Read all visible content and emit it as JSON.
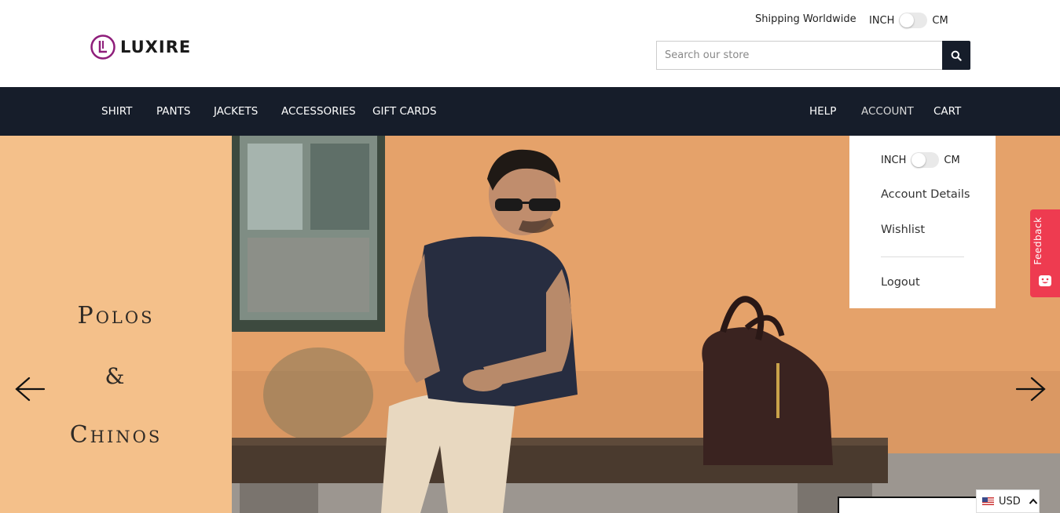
{
  "brand": {
    "name": "LUXIRE",
    "accent_color": "#8e1d7a"
  },
  "header": {
    "shipping_text": "Shipping Worldwide",
    "unit_toggle": {
      "left_label": "INCH",
      "right_label": "CM"
    },
    "search": {
      "placeholder": "Search our store",
      "icon": "search-icon"
    }
  },
  "nav": {
    "left_items": [
      "SHIRT",
      "PANTS",
      "JACKETS",
      "ACCESSORIES",
      "GIFT CARDS"
    ],
    "right_items": [
      "HELP",
      "ACCOUNT",
      "CART"
    ]
  },
  "hero": {
    "line1": "Polos",
    "line2": "&",
    "line3": "Chinos",
    "prev_icon": "arrow-left-icon",
    "next_icon": "arrow-right-icon"
  },
  "account_dropdown": {
    "unit_toggle": {
      "left_label": "INCH",
      "right_label": "CM"
    },
    "items": [
      "Account Details",
      "Wishlist"
    ],
    "logout": "Logout"
  },
  "feedback": {
    "label": "Feedback",
    "icon": "smiley-icon"
  },
  "currency": {
    "code": "USD",
    "flag": "us-flag-icon",
    "icon": "chevron-up-icon"
  },
  "colors": {
    "nav_bg": "#161d2a",
    "hero_left_bg": "#f4c08a",
    "feedback_bg": "#ee3b50"
  }
}
